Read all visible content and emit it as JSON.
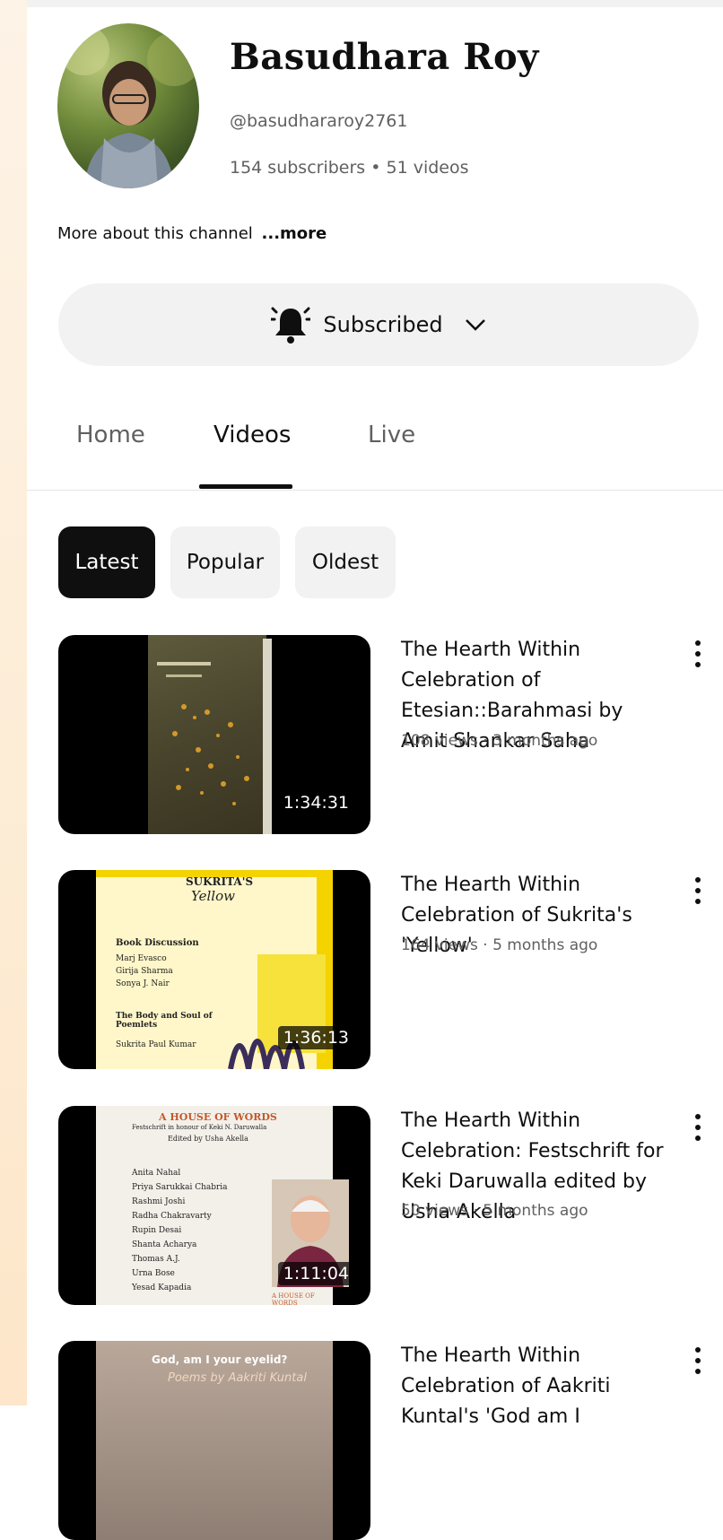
{
  "channel": {
    "name": "Basudhara Roy",
    "handle": "@basudhararoy2761",
    "stats": "154 subscribers • 51 videos",
    "about": "More about this channel",
    "about_more": "...more"
  },
  "subscribe": {
    "label": "Subscribed"
  },
  "tabs": [
    {
      "label": "Home"
    },
    {
      "label": "Videos"
    },
    {
      "label": "Live"
    }
  ],
  "chips": [
    {
      "label": "Latest"
    },
    {
      "label": "Popular"
    },
    {
      "label": "Oldest"
    }
  ],
  "videos": [
    {
      "title": "The Hearth Within Celebration of Etesian::Barahmasi by Amit Shankar Saha",
      "meta": "108 views · 3 months ago",
      "duration": "1:34:31"
    },
    {
      "title": "The Hearth Within Celebration of Sukrita's 'Yellow'",
      "meta": "164 views · 5 months ago",
      "duration": "1:36:13",
      "poster": {
        "heading": "SUKRITA'S",
        "script": "Yellow",
        "section1": "Book Discussion",
        "names1": "Marj Evasco",
        "names2": "Girija Sharma",
        "names3": "Sonya J. Nair",
        "section2": "The Body and Soul of Poemlets",
        "names4": "Sukrita Paul Kumar"
      }
    },
    {
      "title": "The Hearth Within Celebration: Festschrift for Keki Daruwalla edited by Usha Akella",
      "meta": "50 views · 5 months ago",
      "duration": "1:11:04",
      "poster": {
        "heading": "A HOUSE OF WORDS",
        "sub1": "Festschrift in honour of Keki N. Daruwalla",
        "sub2": "Edited by Usha Akella",
        "n1": "Anita Nahal",
        "n2": "Priya Sarukkai Chabria",
        "n3": "Rashmi Joshi",
        "n4": "Radha Chakravarty",
        "n5": "Rupin Desai",
        "n6": "Shanta Acharya",
        "n7": "Thomas A.J.",
        "n8": "Urna Bose",
        "n9": "Yesad Kapadia",
        "foot": "A HOUSE OF WORDS"
      }
    },
    {
      "title": "The Hearth Within Celebration of Aakriti Kuntal's 'God am I",
      "poster": {
        "heading": "God, am I your eyelid?",
        "script": "Poems by Aakriti Kuntal"
      }
    }
  ]
}
